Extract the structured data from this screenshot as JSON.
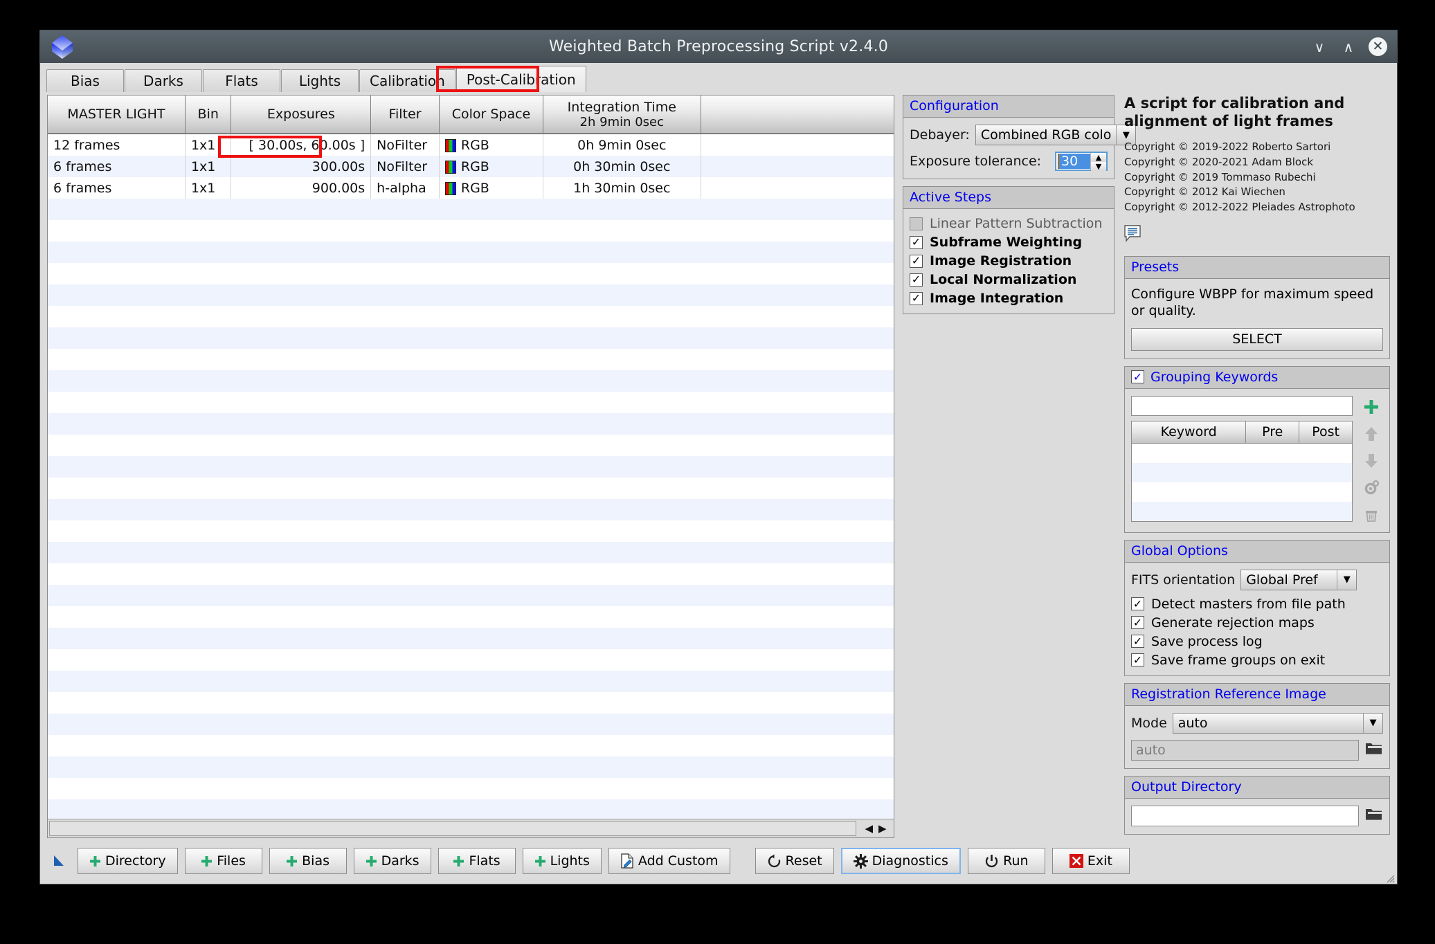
{
  "window": {
    "title": "Weighted Batch Preprocessing Script v2.4.0",
    "logo_icon": "pixinsight-diamond-icon",
    "controls": {
      "minimize": "∨",
      "maximize": "∧",
      "close": "✕"
    }
  },
  "tabs": [
    {
      "label": "Bias",
      "active": false
    },
    {
      "label": "Darks",
      "active": false
    },
    {
      "label": "Flats",
      "active": false
    },
    {
      "label": "Lights",
      "active": false
    },
    {
      "label": "Calibration",
      "active": false
    },
    {
      "label": "Post-Calibration",
      "active": true
    }
  ],
  "table": {
    "headers": [
      "MASTER LIGHT",
      "Bin",
      "Exposures",
      "Filter",
      "Color Space",
      "Integration Time",
      ""
    ],
    "integration_header_sub": "2h  9min  0sec",
    "rows": [
      {
        "frames": "12 frames",
        "bin": "1x1",
        "exposures": "[ 30.00s, 60.00s ]",
        "filter": "NoFilter",
        "color_space": "RGB",
        "integration_time": "0h  9min  0sec",
        "blank": ""
      },
      {
        "frames": "6 frames",
        "bin": "1x1",
        "exposures": "300.00s",
        "filter": "NoFilter",
        "color_space": "RGB",
        "integration_time": "0h 30min  0sec",
        "blank": ""
      },
      {
        "frames": "6 frames",
        "bin": "1x1",
        "exposures": "900.00s",
        "filter": "h-alpha",
        "color_space": "RGB",
        "integration_time": "1h 30min  0sec",
        "blank": ""
      }
    ],
    "scroll_left_icon": "◀",
    "scroll_right_icon": "▶"
  },
  "configuration": {
    "title": "Configuration",
    "debayer_label": "Debayer:",
    "debayer_value": "Combined RGB colo",
    "exposure_tolerance_label": "Exposure tolerance:",
    "exposure_tolerance_value": "30"
  },
  "active_steps": {
    "title": "Active  Steps",
    "items": [
      {
        "label": "Linear Pattern Subtraction",
        "checked": false,
        "bold": false
      },
      {
        "label": "Subframe Weighting",
        "checked": true,
        "bold": true
      },
      {
        "label": "Image Registration",
        "checked": true,
        "bold": true
      },
      {
        "label": "Local Normalization",
        "checked": true,
        "bold": true
      },
      {
        "label": "Image Integration",
        "checked": true,
        "bold": true
      }
    ]
  },
  "description": {
    "headline": "A script for calibration and alignment of light frames",
    "copyright_lines": [
      "Copyright © 2019-2022 Roberto Sartori",
      "Copyright © 2020-2021 Adam Block",
      "Copyright © 2019 Tommaso Rubechi",
      "Copyright © 2012 Kai Wiechen",
      "Copyright © 2012-2022 Pleiades Astrophoto"
    ],
    "bubble_icon": "comment-bubble-icon"
  },
  "presets": {
    "title": "Presets",
    "text": "Configure WBPP for maximum speed or quality.",
    "button": "SELECT"
  },
  "grouping_keywords": {
    "title": "Grouping Keywords",
    "checked": true,
    "input_value": "",
    "columns": [
      "Keyword",
      "Pre",
      "Post"
    ],
    "rows": [],
    "side_buttons": [
      "add-icon",
      "move-up-icon",
      "move-down-icon",
      "settings-gear-icon",
      "delete-trash-icon"
    ]
  },
  "global_options": {
    "title": "Global Options",
    "fits_orientation_label": "FITS orientation",
    "fits_orientation_value": "Global Pref",
    "checkboxes": [
      {
        "label": "Detect masters from file path",
        "checked": true
      },
      {
        "label": "Generate rejection maps",
        "checked": true
      },
      {
        "label": "Save process log",
        "checked": true
      },
      {
        "label": "Save frame groups on exit",
        "checked": true
      }
    ]
  },
  "registration_reference": {
    "title": "Registration Reference Image",
    "mode_label": "Mode",
    "mode_value": "auto",
    "path_placeholder": "auto",
    "path_value": "",
    "folder_icon": "folder-icon"
  },
  "output_directory": {
    "title": "Output Directory",
    "path_value": "",
    "folder_icon": "folder-icon"
  },
  "toolbar": {
    "buttons": [
      {
        "label": "Directory",
        "icon": "plus-icon"
      },
      {
        "label": "Files",
        "icon": "plus-icon"
      },
      {
        "label": "Bias",
        "icon": "plus-icon"
      },
      {
        "label": "Darks",
        "icon": "plus-icon"
      },
      {
        "label": "Flats",
        "icon": "plus-icon"
      },
      {
        "label": "Lights",
        "icon": "plus-icon"
      },
      {
        "label": "Add Custom",
        "icon": "document-pencil-icon"
      },
      {
        "label": "Reset",
        "icon": "reset-circle-icon"
      },
      {
        "label": "Diagnostics",
        "icon": "gear-icon"
      },
      {
        "label": "Run",
        "icon": "power-icon"
      },
      {
        "label": "Exit",
        "icon": "red-x-icon"
      }
    ]
  },
  "colors": {
    "accent_blue": "#0000ee",
    "highlight_red": "#ee1111",
    "titlebar": "#4e585f",
    "panel_bg": "#dcdcdc",
    "row_alt": "#eff3fd",
    "green_plus": "#25ab6e",
    "selection_blue": "#4a90e2"
  }
}
